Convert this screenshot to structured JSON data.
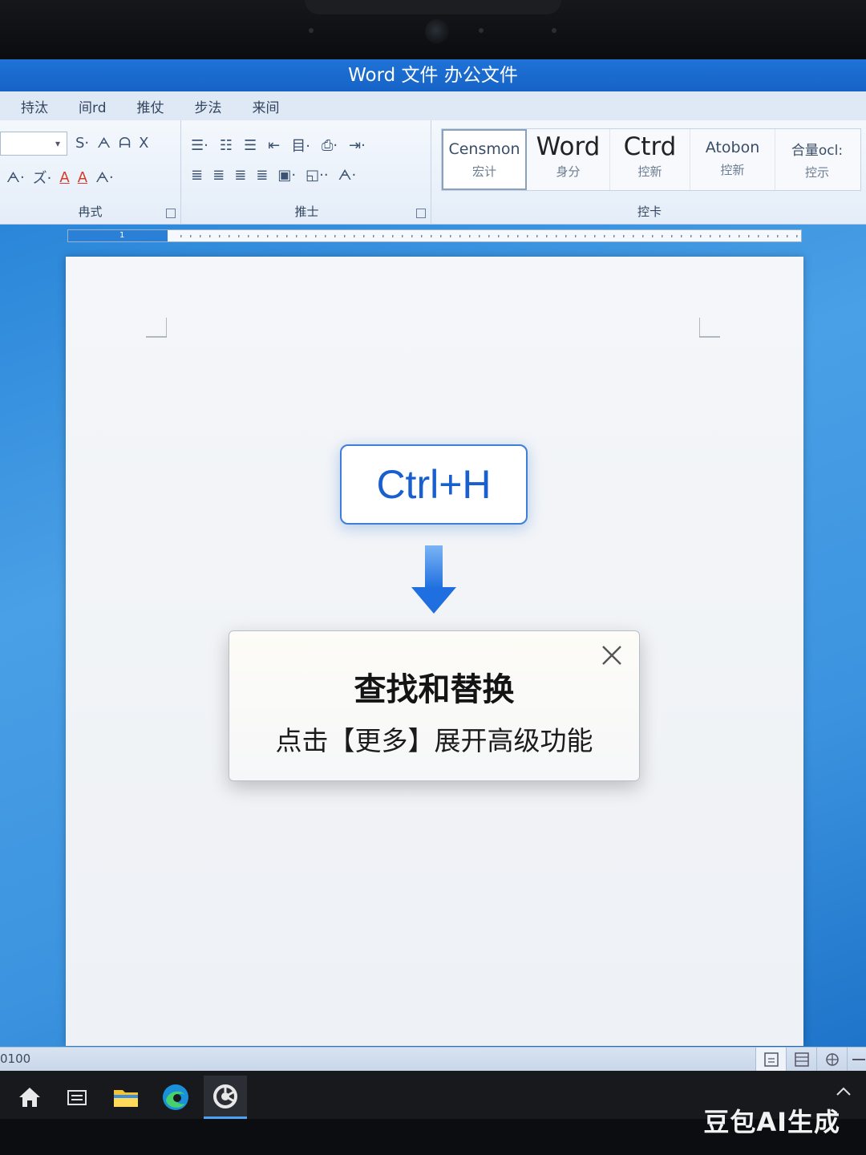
{
  "window": {
    "title": "Word 文件 办公文件"
  },
  "ribbon": {
    "tabs": [
      "持汰",
      "间rd",
      "推仗",
      "步法",
      "来间"
    ],
    "groups": [
      {
        "label": "冉式"
      },
      {
        "label": "推士"
      },
      {
        "label": "控卡"
      }
    ],
    "styles": [
      {
        "name": "Censmon",
        "sub": "宏计"
      },
      {
        "name": "Word",
        "sub": "身分"
      },
      {
        "name": "Ctrd",
        "sub": "控新"
      },
      {
        "name": "Atobon",
        "sub": "控新"
      },
      {
        "name": "合量ocl:",
        "sub": "控示"
      }
    ]
  },
  "ruler": {
    "active_number": "1"
  },
  "callout": {
    "shortcut": "Ctrl+H",
    "dialog_title": "查找和替换",
    "dialog_text": "点击【更多】展开高级功能"
  },
  "statusbar": {
    "left_text": "0100"
  },
  "watermark": "豆包AI生成",
  "colors": {
    "accent": "#1a5fcf",
    "titlebar": "#1f72d6",
    "arrow": "#1f6fe0"
  }
}
